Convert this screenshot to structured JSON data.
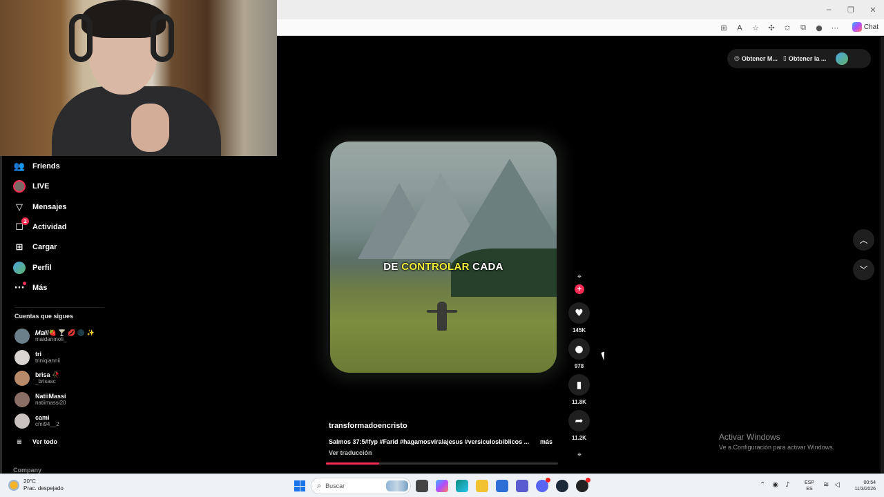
{
  "browser": {
    "chat_label": "Chat",
    "window_controls": [
      "minimize-icon",
      "restore-icon",
      "close-icon"
    ]
  },
  "sidebar": {
    "items": [
      {
        "label": "Friends",
        "icon": "friends-icon"
      },
      {
        "label": "LIVE",
        "icon": "live-avatar"
      },
      {
        "label": "Mensajes",
        "icon": "send-icon"
      },
      {
        "label": "Actividad",
        "icon": "activity-icon",
        "badge": "2"
      },
      {
        "label": "Cargar",
        "icon": "upload-icon"
      },
      {
        "label": "Perfil",
        "icon": "profile-avatar"
      },
      {
        "label": "Más",
        "icon": "more-icon"
      }
    ],
    "following_title": "Cuentas que sigues",
    "following": [
      {
        "name": "𝑀𝑎𝑖𝑖𝑖🍓 🍸 💋 🌑 ✨",
        "user": "maidanmoli_",
        "color": "#6a7f8a"
      },
      {
        "name": "tri",
        "user": "triniqiannii",
        "color": "#d9d4cf"
      },
      {
        "name": "brisa 🥀",
        "user": "_brisasc",
        "color": "#b98a6a"
      },
      {
        "name": "NatiiMassi",
        "user": "natiimassi20",
        "color": "#8a6f66"
      },
      {
        "name": "cami",
        "user": "cmi94__2",
        "color": "#c9c2bf"
      }
    ],
    "see_all": "Ver todo",
    "company": "Company"
  },
  "video": {
    "caption_before": "DE ",
    "caption_highlight": "CONTROLAR",
    "caption_after": " CADA",
    "author": "transformadoencristo",
    "description": "Salmos 37:5#fyp #Farid #hagamosviralajesus #versiculosbiblicos ...",
    "more": "más",
    "translate": "Ver traducción",
    "progress": 0.23
  },
  "actions": {
    "likes": "145K",
    "comments": "978",
    "saves": "11.8K",
    "shares": "11.2K"
  },
  "top_pills": {
    "get_app_1": "Obtener M...",
    "get_app_2": "Obtener la ..."
  },
  "watermark": {
    "line1": "Activar Windows",
    "line2": "Ve a Configuración para activar Windows."
  },
  "taskbar": {
    "temp": "20°C",
    "weather": "Prac. despejado",
    "search_placeholder": "Buscar",
    "lang1": "ESP",
    "lang2": "ES",
    "time": "00:54",
    "date": "11/3/2026"
  }
}
